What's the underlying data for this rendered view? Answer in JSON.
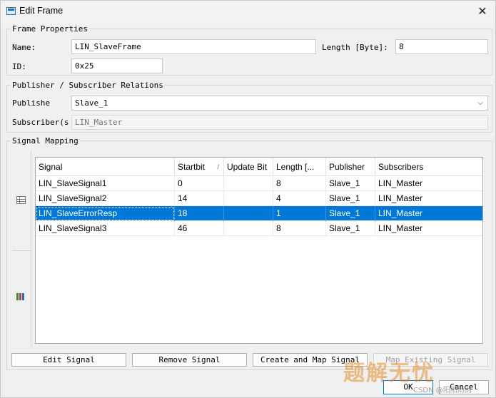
{
  "window": {
    "title": "Edit Frame",
    "close_glyph": "✕"
  },
  "frame_properties": {
    "group_label": "Frame Properties",
    "name_label": "Name:",
    "name_value": "LIN_SlaveFrame",
    "length_label": "Length [Byte]:",
    "length_value": "8",
    "id_label": "ID:",
    "id_value": "0x25"
  },
  "relations": {
    "group_label": "Publisher / Subscriber Relations",
    "publisher_label": "Publishe",
    "publisher_value": "Slave_1",
    "subscriber_label": "Subscriber(s",
    "subscriber_value": "LIN_Master"
  },
  "signal_mapping": {
    "group_label": "Signal Mapping",
    "side_icons": [
      "table-view-icon",
      "mapping-view-icon"
    ],
    "columns": [
      "Signal",
      "Startbit",
      "Update Bit",
      "Length [...",
      "Publisher",
      "Subscribers"
    ],
    "sort_indicator": "/",
    "rows": [
      {
        "signal": "LIN_SlaveSignal1",
        "startbit": "0",
        "update_bit": "",
        "length": "8",
        "publisher": "Slave_1",
        "subscribers": "LIN_Master",
        "selected": false
      },
      {
        "signal": "LIN_SlaveSignal2",
        "startbit": "14",
        "update_bit": "",
        "length": "4",
        "publisher": "Slave_1",
        "subscribers": "LIN_Master",
        "selected": false
      },
      {
        "signal": "LIN_SlaveErrorResp",
        "startbit": "18",
        "update_bit": "",
        "length": "1",
        "publisher": "Slave_1",
        "subscribers": "LIN_Master",
        "selected": true
      },
      {
        "signal": "LIN_SlaveSignal3",
        "startbit": "46",
        "update_bit": "",
        "length": "8",
        "publisher": "Slave_1",
        "subscribers": "LIN_Master",
        "selected": false
      }
    ],
    "selection_color": "#0078d7"
  },
  "buttons": {
    "edit_signal": "Edit Signal",
    "remove_signal": "Remove Signal",
    "create_map_signal": "Create and Map Signal",
    "map_existing_signal": "Map Existing Signal",
    "ok": "OK",
    "cancel": "Cancel"
  },
  "watermark": {
    "main": "题解无忧",
    "sub": "CSDN @阳阳雨雨"
  }
}
